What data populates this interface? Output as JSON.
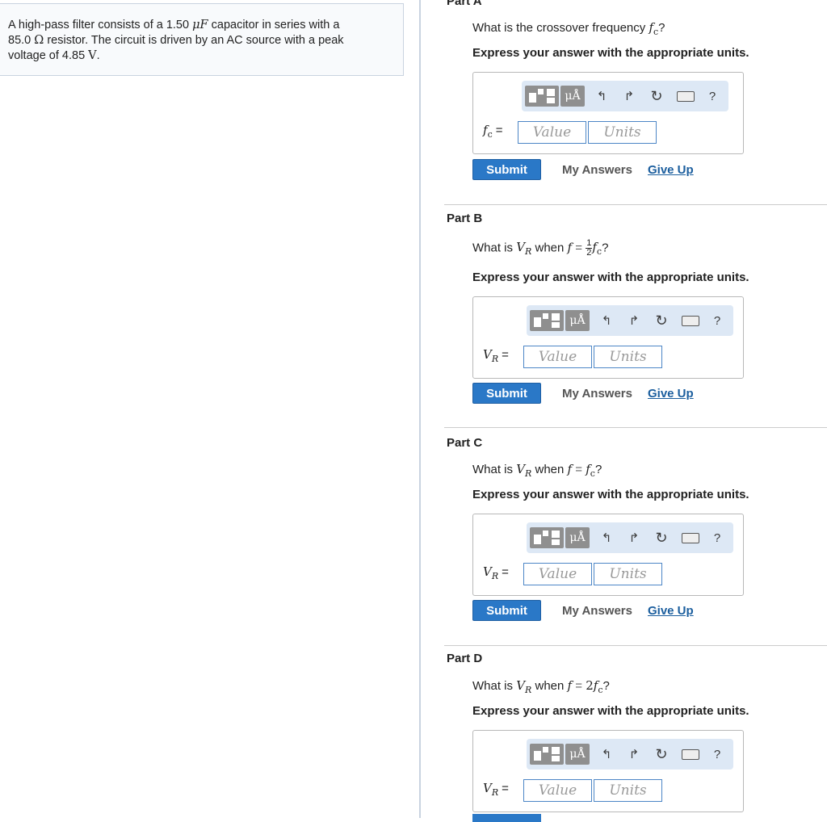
{
  "problem": {
    "line1_prefix": "A high-pass filter consists of a 1.50",
    "line1_unit": "μF",
    "line1_suffix": "capacitor in series with a",
    "line2_value": "85.0",
    "line2_unit": "Ω",
    "line2_suffix": "resistor. The circuit is driven by an AC source with a peak",
    "line3_prefix": "voltage of 4.85",
    "line3_unit": "V",
    "line3_suffix": "."
  },
  "parts": [
    {
      "title": "Part A",
      "question_prefix": "What is the crossover frequency",
      "question_var": "f",
      "question_sub": "c",
      "question_suffix": "?",
      "instruction": "Express your answer with the appropriate units.",
      "label_var": "f",
      "label_sub": "c",
      "label_eq": "=",
      "value_placeholder": "Value",
      "units_placeholder": "Units"
    },
    {
      "title": "Part B",
      "question_prefix": "What is",
      "question_var": "V",
      "question_sub": "R",
      "question_mid": "when",
      "question_f": "f",
      "question_eq": "=",
      "question_frac_num": "1",
      "question_frac_den": "2",
      "question_rhs_var": "f",
      "question_rhs_sub": "c",
      "question_suffix": "?",
      "instruction": "Express your answer with the appropriate units.",
      "label_var": "V",
      "label_sub": "R",
      "label_eq": "=",
      "value_placeholder": "Value",
      "units_placeholder": "Units"
    },
    {
      "title": "Part C",
      "question_prefix": "What is",
      "question_var": "V",
      "question_sub": "R",
      "question_mid": "when",
      "question_f": "f",
      "question_eq": "=",
      "question_rhs_var": "f",
      "question_rhs_sub": "c",
      "question_suffix": "?",
      "instruction": "Express your answer with the appropriate units.",
      "label_var": "V",
      "label_sub": "R",
      "label_eq": "=",
      "value_placeholder": "Value",
      "units_placeholder": "Units"
    },
    {
      "title": "Part D",
      "question_prefix": "What is",
      "question_var": "V",
      "question_sub": "R",
      "question_mid": "when",
      "question_f": "f",
      "question_eq": "=",
      "question_coef": "2",
      "question_rhs_var": "f",
      "question_rhs_sub": "c",
      "question_suffix": "?",
      "instruction": "Express your answer with the appropriate units.",
      "label_var": "V",
      "label_sub": "R",
      "label_eq": "=",
      "value_placeholder": "Value",
      "units_placeholder": "Units"
    }
  ],
  "toolbar": {
    "mu_label": "μÅ",
    "help_label": "?",
    "icons": [
      "template-icon",
      "units-icon",
      "undo-icon",
      "redo-icon",
      "reset-icon",
      "keyboard-icon",
      "help-icon"
    ]
  },
  "actions": {
    "submit_label": "Submit",
    "my_answers_label": "My Answers",
    "give_up_label": "Give Up"
  },
  "colors": {
    "submit_bg": "#2a78c7",
    "link": "#1b5e9e",
    "toolbar_bg": "#dde8f5",
    "input_border": "#4c86c6"
  }
}
